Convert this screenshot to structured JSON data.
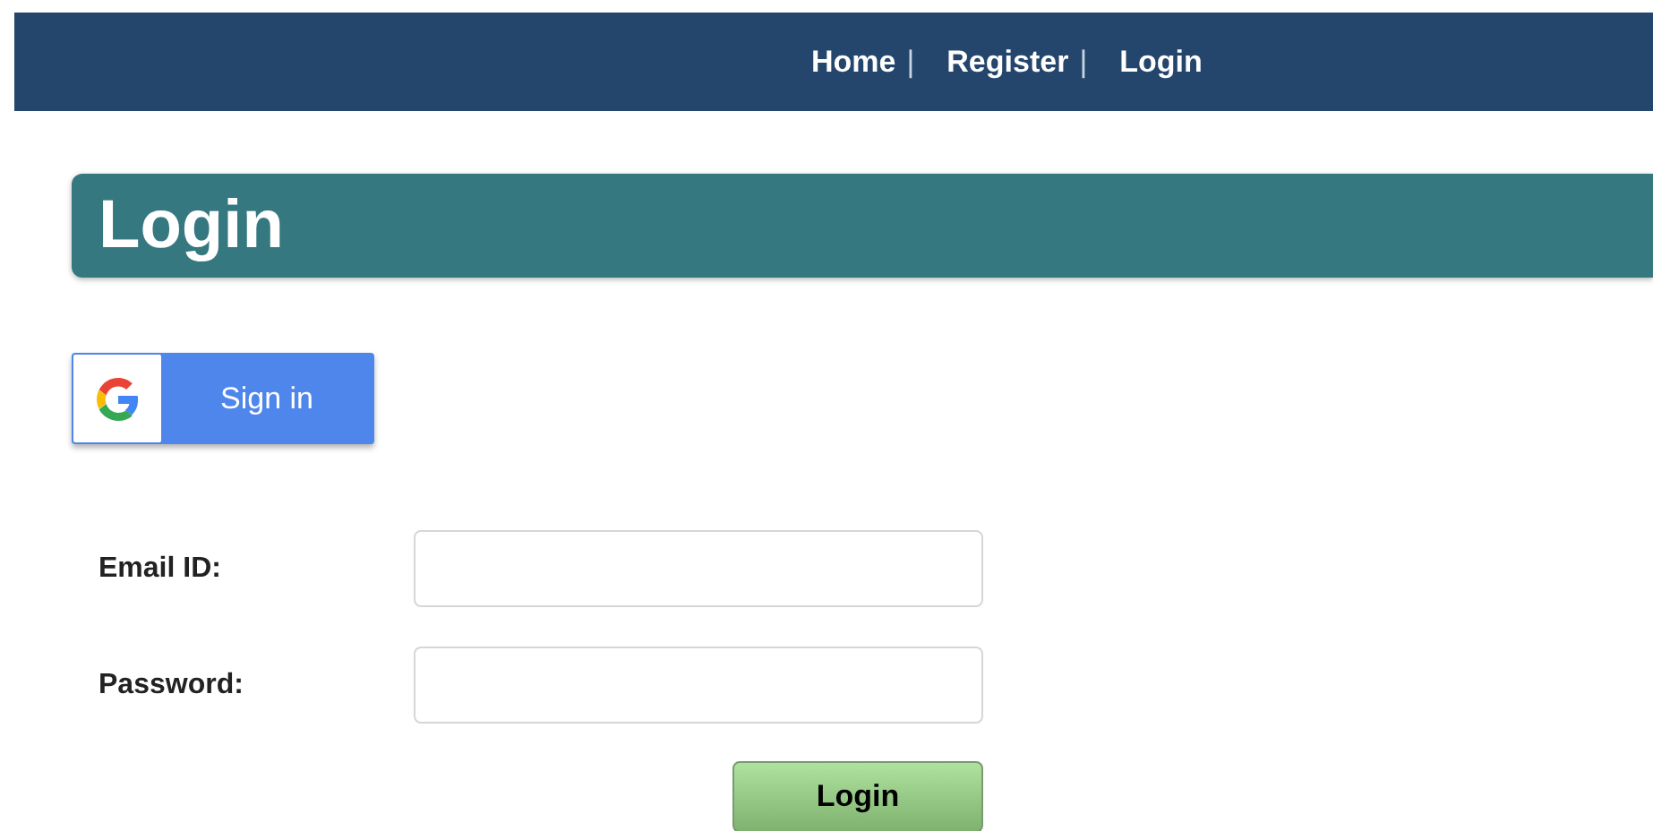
{
  "nav": [
    {
      "label": "Home",
      "separator": "|"
    },
    {
      "label": "Register",
      "separator": "|"
    },
    {
      "label": "Login"
    }
  ],
  "heading": "Login",
  "google_button": {
    "label": "Sign in"
  },
  "fields": [
    {
      "label": "Email ID:"
    },
    {
      "label": "Password:"
    }
  ],
  "submit": "Login"
}
